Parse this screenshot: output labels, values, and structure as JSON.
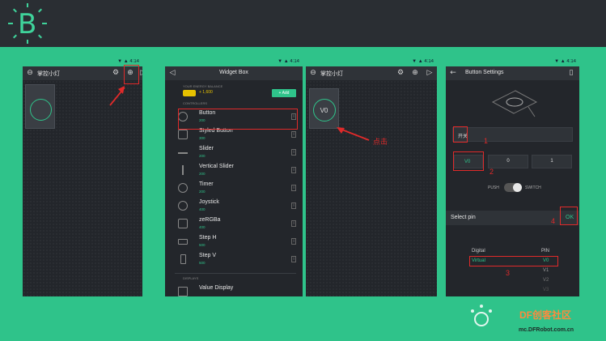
{
  "logo": {
    "letter": "B"
  },
  "panel1": {
    "status": "▼ ▲ 4:14",
    "title": "掌控小灯"
  },
  "panel2": {
    "status": "▼ ▲ 4:14",
    "title": "Widget Box",
    "energy_caption": "YOUR ENERGY BALANCE",
    "energy_value": "+ 1,600",
    "add_label": "+ Add",
    "section_controllers": "CONTROLLERS",
    "section_displays": "DISPLAYS",
    "items": [
      {
        "name": "Button",
        "price": "200"
      },
      {
        "name": "Styled Button",
        "price": "300"
      },
      {
        "name": "Slider",
        "price": "200"
      },
      {
        "name": "Vertical Slider",
        "price": "200"
      },
      {
        "name": "Timer",
        "price": "200"
      },
      {
        "name": "Joystick",
        "price": "400"
      },
      {
        "name": "zeRGBa",
        "price": "400"
      },
      {
        "name": "Step H",
        "price": "500"
      },
      {
        "name": "Step V",
        "price": "500"
      },
      {
        "name": "Value Display",
        "price": ""
      }
    ],
    "info_glyph": "i"
  },
  "panel3": {
    "status": "▼ ▲ 4:14",
    "title": "掌控小灯",
    "widget_label": "V0"
  },
  "panel4": {
    "status": "▼ ▲ 4:14",
    "title": "Button Settings",
    "name_value": "开关",
    "pin_value": "V0",
    "val_low": "0",
    "val_high": "1",
    "mode_push": "PUSH",
    "mode_switch": "SWITCH",
    "select_pin_title": "Select pin",
    "ok_label": "OK",
    "col_left": "Digital",
    "col_right": "PIN",
    "row_left": "Virtual",
    "pins": [
      "V0",
      "V1",
      "V2",
      "V3"
    ]
  },
  "annotations": {
    "click_label": "点击",
    "n1": "1",
    "n2": "2",
    "n3": "3",
    "n4": "4"
  },
  "watermark": {
    "brand": "DF创客社区",
    "url": "mc.DFRobot.com.cn"
  },
  "colors": {
    "accent": "#2fc38a",
    "dark": "#23262b",
    "topbar": "#2a2e33",
    "annotation": "#e02a2a"
  }
}
